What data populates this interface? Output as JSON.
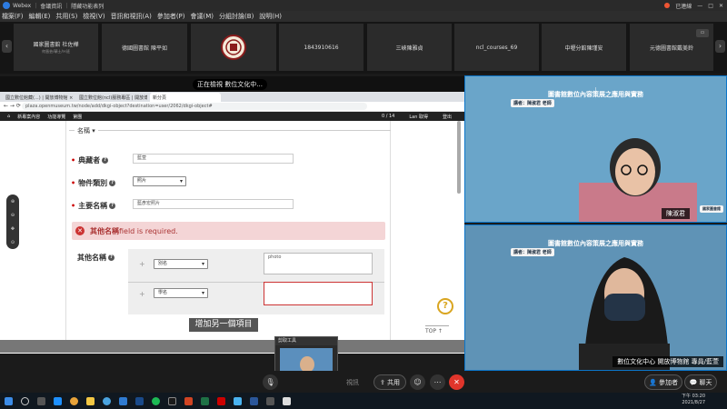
{
  "window": {
    "app_name": "Webex",
    "meeting_info": "會議資訊",
    "screen_controls": "隱藏功能表列",
    "status": "已連線"
  },
  "menu": [
    "檔案(F)",
    "編輯(E)",
    "共用(S)",
    "檢視(V)",
    "音訊和視訊(A)",
    "參加者(P)",
    "會議(M)",
    "分組討論(B)",
    "說明(H)"
  ],
  "participants": [
    {
      "name": "國家圖書館 杜佐樺",
      "sub": "何晉芸/碩士/Ｈ班"
    },
    {
      "name": "德國圖書館 陳平如",
      "sub": ""
    },
    {
      "name": "",
      "sub": ""
    },
    {
      "name": "1843910616",
      "sub": ""
    },
    {
      "name": "三峽陳雅貞",
      "sub": ""
    },
    {
      "name": "ncl_courses_69",
      "sub": ""
    },
    {
      "name": "中壢分館陳瑾安",
      "sub": ""
    },
    {
      "name": "元德圖書館戴美鈴",
      "sub": ""
    }
  ],
  "share_banner": "正在檢視 數位文化中...",
  "browser": {
    "tabs": [
      "國立數位館藏(...) | 開放博物館 × ",
      "國立數位館(ncl)服務專區 | 開放博物 × ",
      "新分頁"
    ],
    "url": "plaza.openmuseum.tw/node/add/dkgi-object?destination=user/2062/dkgi-object#",
    "site_nav": [
      "新專案內容",
      "功能導覽",
      "第團"
    ],
    "site_nav_right": [
      "0 / 14",
      "Lan 取得",
      "登出"
    ]
  },
  "form": {
    "section_label": "名稱 ▾",
    "holder_label": "典藏者",
    "holder_value": "藍萱",
    "type_label": "物件類別",
    "type_value": "照片",
    "title_label": "主要名稱",
    "title_value": "藍彥宏照片",
    "error_field": "其他名稱",
    "error_message": " field is required.",
    "other_label": "其他名稱",
    "rows": [
      {
        "type": "別名",
        "value": "photo"
      },
      {
        "type": "學名",
        "value": ""
      }
    ],
    "add_button": "增加另一個項目",
    "top_label": "TOP ↑"
  },
  "videos": [
    {
      "slide_title": "圖書館數位內容策展之應用與實務",
      "lecturer": "講者：陳淑君 老師",
      "name": "陳淑君",
      "badge": "國家圖書館"
    },
    {
      "slide_title": "圖書館數位內容策展之應用與實務",
      "lecturer": "講者：陳淑君 老師",
      "name": "數位文化中心 開放博物館 專員/藍萱"
    }
  ],
  "preview_label": "剪取工具",
  "controls": {
    "share": "共用",
    "participants": "參加者",
    "chat": "聊天",
    "video_hint": "視訊"
  },
  "clock": {
    "time": "下午 03:20",
    "date": "2021/8/27"
  },
  "colors": {
    "accent": "#0b75c9",
    "error_bg": "#f4d5d6",
    "end_call": "#e0352b"
  }
}
